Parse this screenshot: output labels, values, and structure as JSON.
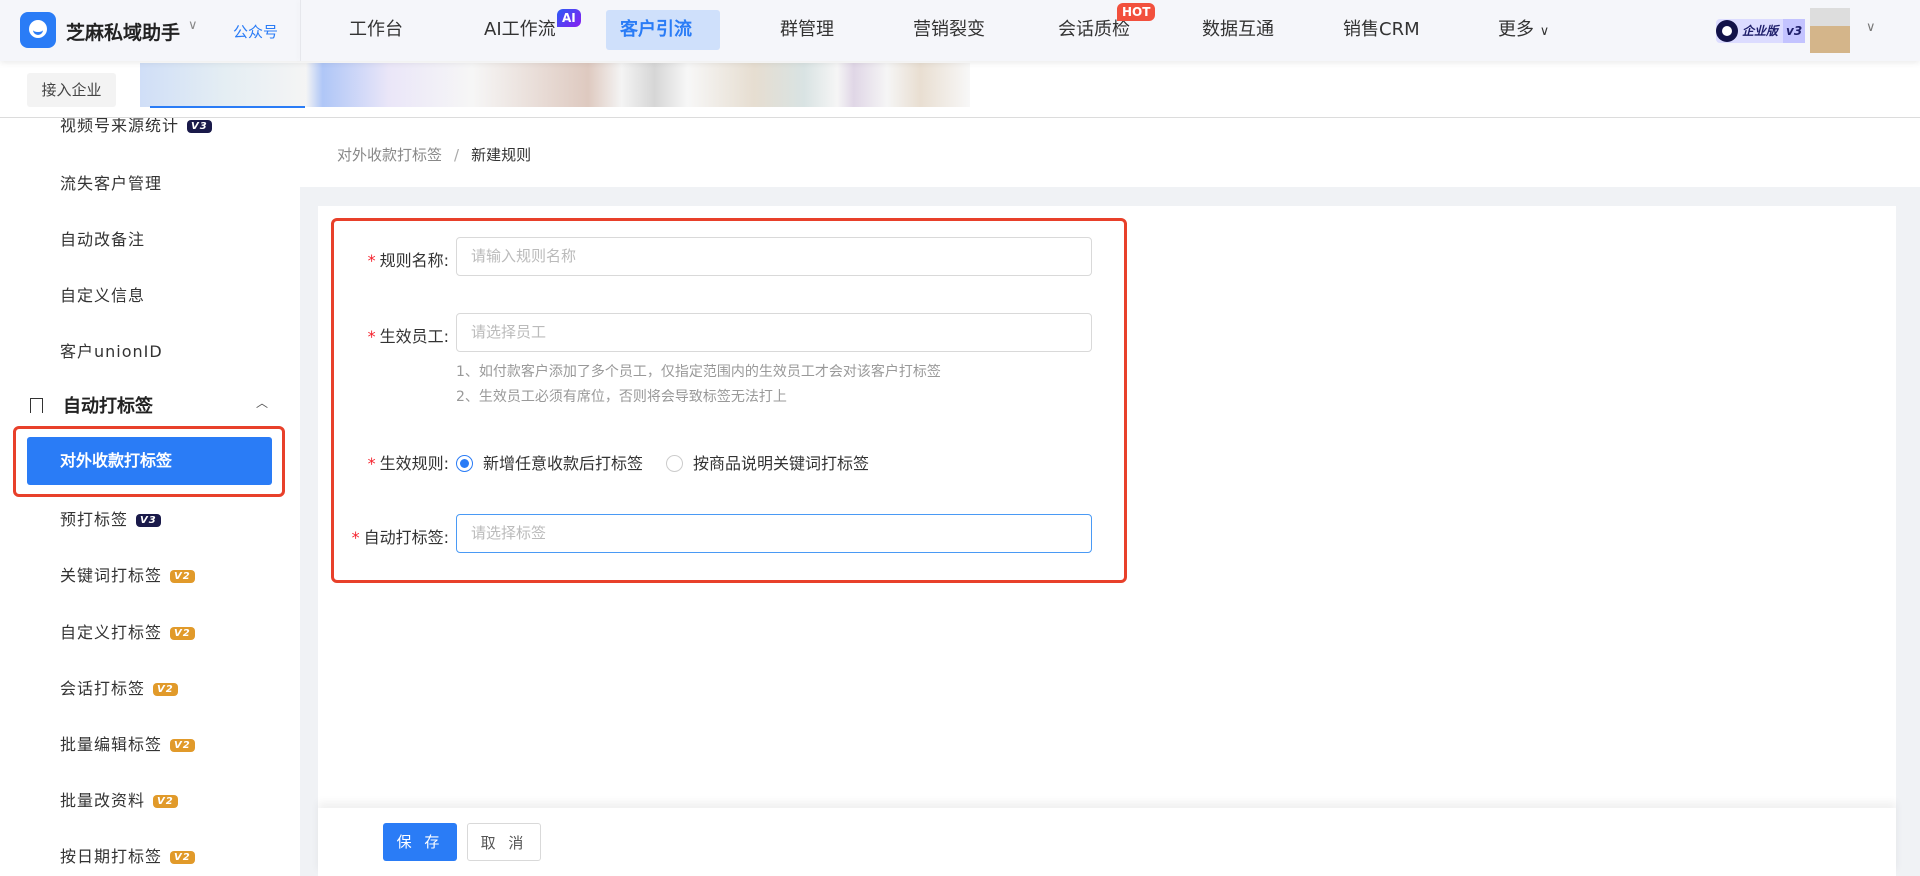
{
  "header": {
    "app_title": "芝麻私域助手",
    "account_type": "公众号",
    "nav": [
      {
        "label": "工作台"
      },
      {
        "label": "AI工作流",
        "badge": "AI"
      },
      {
        "label": "客户引流",
        "active": true
      },
      {
        "label": "群管理"
      },
      {
        "label": "营销裂变"
      },
      {
        "label": "会话质检",
        "badge": "HOT"
      },
      {
        "label": "数据互通"
      },
      {
        "label": "销售CRM"
      },
      {
        "label": "更多"
      }
    ],
    "edition_badge": "企业版",
    "edition_version": "v3"
  },
  "subbar": {
    "join_button": "接入企业"
  },
  "sidebar": {
    "items": [
      {
        "label": "视频号来源统计",
        "badge": "V3"
      },
      {
        "label": "流失客户管理"
      },
      {
        "label": "自动改备注"
      },
      {
        "label": "自定义信息"
      },
      {
        "label": "客户unionID"
      }
    ],
    "group": {
      "label": "自动打标签",
      "expanded": true
    },
    "active_item": "对外收款打标签",
    "group_items": [
      {
        "label": "预打标签",
        "badge": "V3"
      },
      {
        "label": "关键词打标签",
        "badge": "V2"
      },
      {
        "label": "自定义打标签",
        "badge": "V2"
      },
      {
        "label": "会话打标签",
        "badge": "V2"
      },
      {
        "label": "批量编辑标签",
        "badge": "V2"
      },
      {
        "label": "批量改资料",
        "badge": "V2"
      },
      {
        "label": "按日期打标签",
        "badge": "V2"
      }
    ]
  },
  "breadcrumb": {
    "parent": "对外收款打标签",
    "separator": "/",
    "current": "新建规则"
  },
  "form": {
    "rule_name": {
      "label": "规则名称:",
      "placeholder": "请输入规则名称"
    },
    "staff": {
      "label": "生效员工:",
      "placeholder": "请选择员工",
      "hints": [
        "1、如付款客户添加了多个员工，仅指定范围内的生效员工才会对该客户打标签",
        "2、生效员工必须有席位，否则将会导致标签无法打上"
      ]
    },
    "rule": {
      "label": "生效规则:",
      "options": [
        "新增任意收款后打标签",
        "按商品说明关键词打标签"
      ],
      "selected": "新增任意收款后打标签"
    },
    "tags": {
      "label": "自动打标签:",
      "placeholder": "请选择标签"
    }
  },
  "footer": {
    "save": "保 存",
    "cancel": "取 消"
  },
  "colors": {
    "primary": "#2a7cf6",
    "highlight": "#e8402a",
    "required": "#f5222d"
  }
}
